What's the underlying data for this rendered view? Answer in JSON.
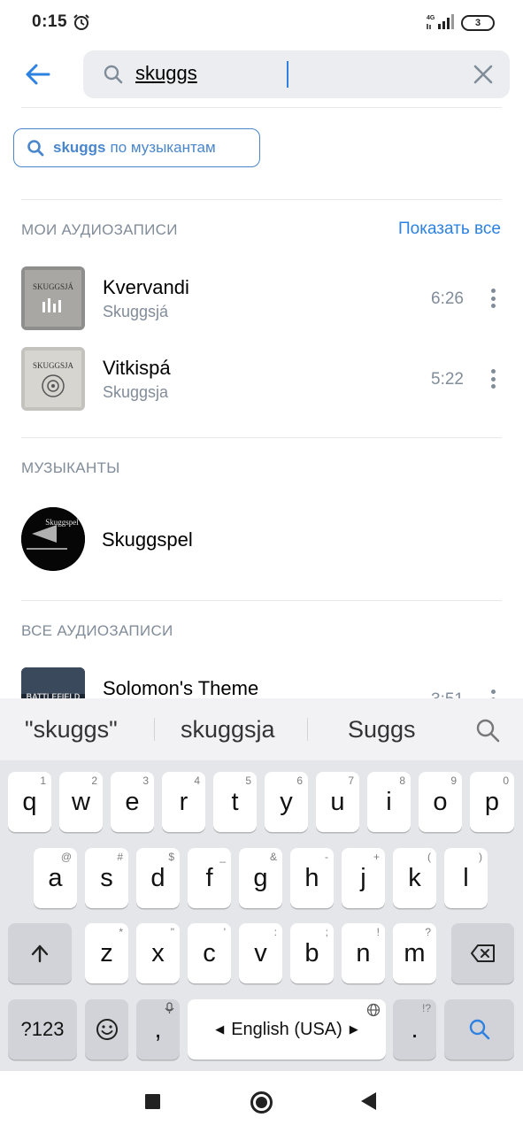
{
  "status_bar": {
    "time": "0:15",
    "network": "4G",
    "battery": "3"
  },
  "search": {
    "query": "skuggs"
  },
  "chip": {
    "query": "skuggs",
    "label": "по музыкантам"
  },
  "my_audio": {
    "title": "МОИ АУДИОЗАПИСИ",
    "show_all": "Показать все",
    "tracks": [
      {
        "title": "Kvervandi",
        "artist": "Skuggsjá",
        "duration": "6:26"
      },
      {
        "title": "Vitkispá",
        "artist": "Skuggsja",
        "duration": "5:22"
      }
    ]
  },
  "musicians": {
    "title": "МУЗЫКАНТЫ",
    "items": [
      {
        "name": "Skuggspel",
        "cover_text": "Skuggspel"
      }
    ]
  },
  "all_audio": {
    "title": "ВСЕ АУДИОЗАПИСИ",
    "tracks": [
      {
        "title": "Solomon's Theme",
        "duration": "3:51"
      }
    ]
  },
  "keyboard": {
    "suggestions": [
      "\"skuggs\"",
      "skuggsja",
      "Suggs"
    ],
    "row1": [
      {
        "k": "q",
        "h": "1"
      },
      {
        "k": "w",
        "h": "2"
      },
      {
        "k": "e",
        "h": "3"
      },
      {
        "k": "r",
        "h": "4"
      },
      {
        "k": "t",
        "h": "5"
      },
      {
        "k": "y",
        "h": "6"
      },
      {
        "k": "u",
        "h": "7"
      },
      {
        "k": "i",
        "h": "8"
      },
      {
        "k": "o",
        "h": "9"
      },
      {
        "k": "p",
        "h": "0"
      }
    ],
    "row2": [
      {
        "k": "a",
        "h": "@"
      },
      {
        "k": "s",
        "h": "#"
      },
      {
        "k": "d",
        "h": "$"
      },
      {
        "k": "f",
        "h": "_"
      },
      {
        "k": "g",
        "h": "&"
      },
      {
        "k": "h",
        "h": "-"
      },
      {
        "k": "j",
        "h": "+"
      },
      {
        "k": "k",
        "h": "("
      },
      {
        "k": "l",
        "h": ")"
      }
    ],
    "row3": [
      {
        "k": "z",
        "h": "*"
      },
      {
        "k": "x",
        "h": "\""
      },
      {
        "k": "c",
        "h": "'"
      },
      {
        "k": "v",
        "h": ":"
      },
      {
        "k": "b",
        "h": ";"
      },
      {
        "k": "n",
        "h": "!"
      },
      {
        "k": "m",
        "h": "?"
      }
    ],
    "symbols_label": "?123",
    "comma": ",",
    "space_label": "English (USA)",
    "period": ".",
    "period_hint": "!?"
  },
  "colors": {
    "accent": "#2d81e0",
    "secondary_text": "#818c99",
    "chip_border": "#4986cc"
  }
}
